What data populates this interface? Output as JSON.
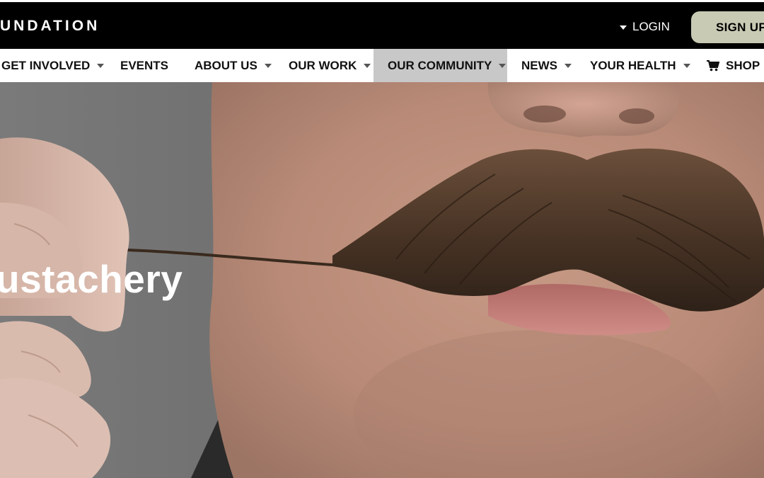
{
  "header": {
    "logo_text": "UNDATION",
    "login_label": "LOGIN",
    "signup_label": "SIGN UP"
  },
  "nav": {
    "items": [
      {
        "label": "GET INVOLVED",
        "has_dropdown": true
      },
      {
        "label": "EVENTS",
        "has_dropdown": false
      },
      {
        "label": "ABOUT US",
        "has_dropdown": true
      },
      {
        "label": "OUR WORK",
        "has_dropdown": true
      },
      {
        "label": "OUR COMMUNITY",
        "has_dropdown": true,
        "active": true
      },
      {
        "label": "NEWS",
        "has_dropdown": true
      },
      {
        "label": "YOUR HEALTH",
        "has_dropdown": true
      },
      {
        "label": "SHOP",
        "has_dropdown": true,
        "icon": "cart-icon"
      }
    ]
  },
  "hero": {
    "title": "ustachery",
    "image_subject": "close-up of a man twirling his moustache"
  },
  "colors": {
    "topbar": "#000000",
    "signup_bg": "#c9cab4",
    "active_nav_bg": "#c8c8c8",
    "hero_text": "#ffffff"
  }
}
